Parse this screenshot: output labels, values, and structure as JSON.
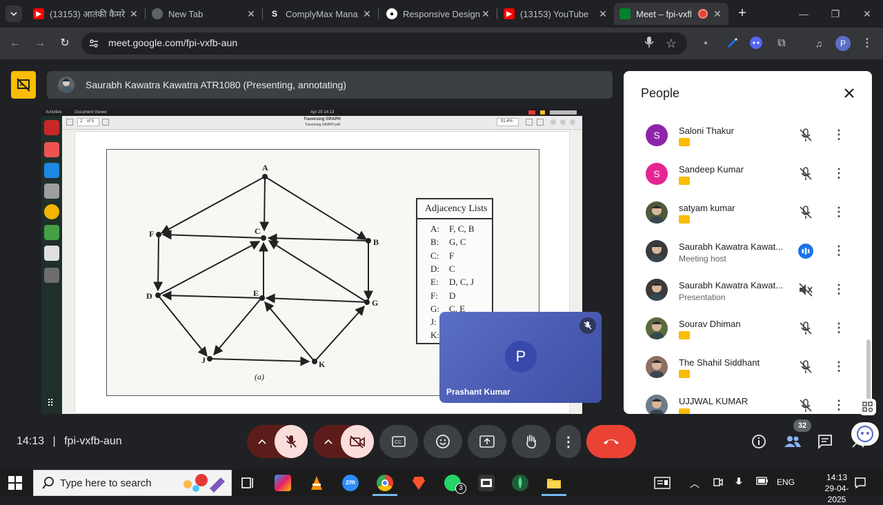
{
  "browser": {
    "tabs": [
      {
        "label": "(13153) आतंकी कैमरे",
        "favicon": "youtube-icon"
      },
      {
        "label": "New Tab",
        "favicon": "chrome-icon"
      },
      {
        "label": "ComplyMax Mana",
        "favicon": "s-icon"
      },
      {
        "label": "Responsive Design",
        "favicon": "github-icon"
      },
      {
        "label": "(13153) YouTube",
        "favicon": "youtube-icon"
      },
      {
        "label": "Meet – fpi-vxfb",
        "favicon": "meet-icon",
        "active": true
      }
    ],
    "url": "meet.google.com/fpi-vxfb-aun",
    "profile_initial": "P"
  },
  "meet": {
    "presenter_banner": "Saurabh Kawatra Kawatra ATR1080 (Presenting, annotating)",
    "shared_screen": {
      "topbar_activities": "Activities",
      "topbar_app": "Document Viewer",
      "topbar_date": "Apr 29  14:13",
      "doc_title": "Traversing GRAPH",
      "doc_subtitle": "Traversing GRAPH.pdf",
      "page_indicator": "2",
      "page_total": "of 5",
      "zoom": "91.4%",
      "graph_caption": "(a)",
      "graph_nodes": [
        "A",
        "B",
        "C",
        "D",
        "E",
        "F",
        "G",
        "J",
        "K"
      ],
      "adjacency_title": "Adjacency Lists",
      "adjacency_rows": [
        {
          "node": "A:",
          "list": "F, C, B"
        },
        {
          "node": "B:",
          "list": "G, C"
        },
        {
          "node": "C:",
          "list": "F"
        },
        {
          "node": "D:",
          "list": "C"
        },
        {
          "node": "E:",
          "list": "D, C, J"
        },
        {
          "node": "F:",
          "list": "D"
        },
        {
          "node": "G:",
          "list": "C, E"
        },
        {
          "node": "J:",
          "list": ""
        },
        {
          "node": "K:",
          "list": ""
        }
      ]
    },
    "self_tile": {
      "initial": "P",
      "name": "Prashant Kumar"
    },
    "people_panel": {
      "title": "People",
      "participants": [
        {
          "name": "Saloni Thakur",
          "initial": "S",
          "color": "#8e24aa",
          "sub": "",
          "mic": "muted"
        },
        {
          "name": "Sandeep Kumar",
          "initial": "S",
          "color": "#e52592",
          "sub": "",
          "mic": "muted"
        },
        {
          "name": "satyam kumar",
          "initial": "",
          "color": "#4e5a3a",
          "sub": "",
          "mic": "muted"
        },
        {
          "name": "Saurabh Kawatra Kawat...",
          "initial": "",
          "color": "#3a3a3a",
          "sub": "Meeting host",
          "mic": "speaking"
        },
        {
          "name": "Saurabh Kawatra Kawat...",
          "initial": "",
          "color": "#3a3a3a",
          "sub": "Presentation",
          "mic": "volume-off"
        },
        {
          "name": "Sourav Dhiman",
          "initial": "",
          "color": "#5a6b3e",
          "sub": "",
          "mic": "muted"
        },
        {
          "name": "The Shahil Siddhant",
          "initial": "",
          "color": "#8d6e63",
          "sub": "",
          "mic": "muted"
        },
        {
          "name": "UJJWAL KUMAR",
          "initial": "",
          "color": "#6d7a8a",
          "sub": "",
          "mic": "muted"
        }
      ]
    },
    "bottom_bar": {
      "time": "14:13",
      "separator": "|",
      "meeting_code": "fpi-vxfb-aun",
      "participant_count": "32"
    }
  },
  "taskbar": {
    "search_placeholder": "Type here to search",
    "whatsapp_badge": "3",
    "language": "ENG",
    "time": "14:13",
    "date": "29-04-2025"
  }
}
